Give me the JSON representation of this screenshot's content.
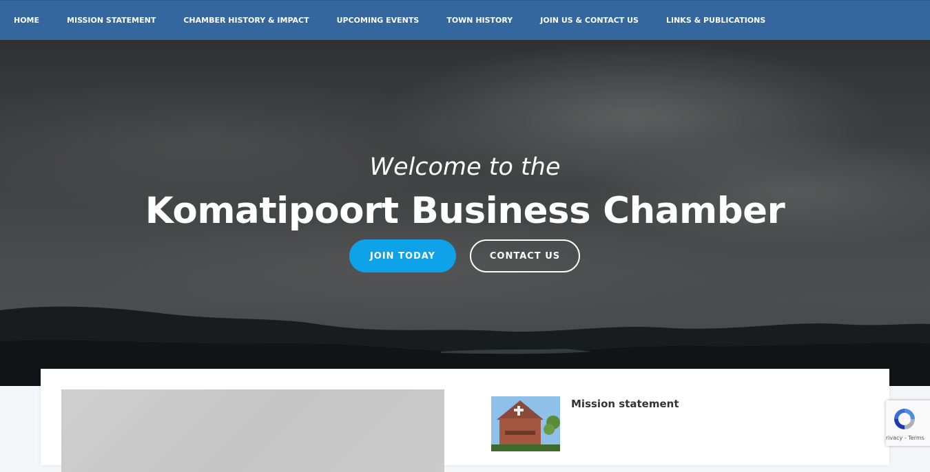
{
  "nav": {
    "items": [
      {
        "label": "HOME"
      },
      {
        "label": "MISSION STATEMENT"
      },
      {
        "label": "CHAMBER HISTORY & IMPACT"
      },
      {
        "label": "UPCOMING EVENTS"
      },
      {
        "label": "TOWN HISTORY"
      },
      {
        "label": "JOIN US & CONTACT US"
      },
      {
        "label": "LINKS & PUBLICATIONS"
      }
    ]
  },
  "hero": {
    "subtitle": "Welcome to the",
    "title": "Komatipoort Business Chamber",
    "join_label": "JOIN TODAY",
    "contact_label": "CONTACT US"
  },
  "content": {
    "post_title": "Mission statement"
  },
  "recaptcha": {
    "text": "rivacy - Terms"
  },
  "colors": {
    "nav_bg": "#33679e",
    "join_button": "#0ea2e8"
  }
}
